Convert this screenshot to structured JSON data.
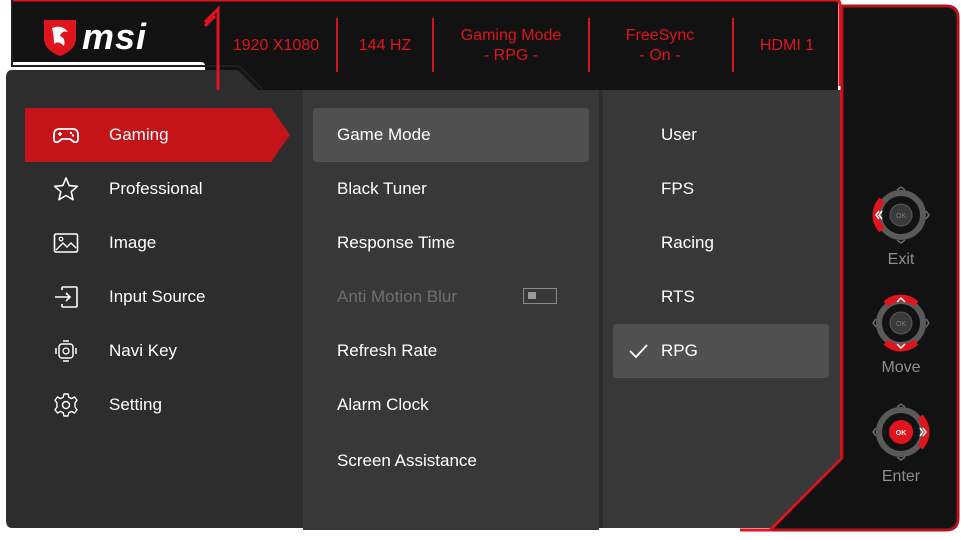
{
  "brand": {
    "logo_text": "msi"
  },
  "header": {
    "resolution": "1920 X1080",
    "refresh": "144 HZ",
    "mode_line1": "Gaming Mode",
    "mode_line2": "- RPG -",
    "sync_line1": "FreeSync",
    "sync_line2": "- On -",
    "input": "HDMI 1"
  },
  "categories": [
    {
      "label": "Gaming",
      "icon": "gamepad-icon",
      "selected": true
    },
    {
      "label": "Professional",
      "icon": "star-icon"
    },
    {
      "label": "Image",
      "icon": "image-icon"
    },
    {
      "label": "Input Source",
      "icon": "input-source-icon"
    },
    {
      "label": "Navi Key",
      "icon": "navi-key-icon"
    },
    {
      "label": "Setting",
      "icon": "gear-icon"
    }
  ],
  "submenu": [
    {
      "label": "Game Mode",
      "selected": true
    },
    {
      "label": "Black Tuner"
    },
    {
      "label": "Response Time"
    },
    {
      "label": "Anti Motion Blur",
      "disabled": true,
      "toggle": "off"
    },
    {
      "label": "Refresh Rate"
    },
    {
      "label": "Alarm Clock"
    },
    {
      "label": "Screen Assistance"
    }
  ],
  "options": [
    {
      "label": "User"
    },
    {
      "label": "FPS"
    },
    {
      "label": "Racing"
    },
    {
      "label": "RTS"
    },
    {
      "label": "RPG",
      "selected": true,
      "checked": true
    }
  ],
  "navi": {
    "exit": "Exit",
    "move": "Move",
    "enter": "Enter",
    "ok": "OK"
  },
  "colors": {
    "accent": "#e0141c",
    "panel_bg": "#2f2f2f",
    "menu_bg": "#383838",
    "selected_bg": "#505050",
    "dark_bg": "#161616"
  }
}
